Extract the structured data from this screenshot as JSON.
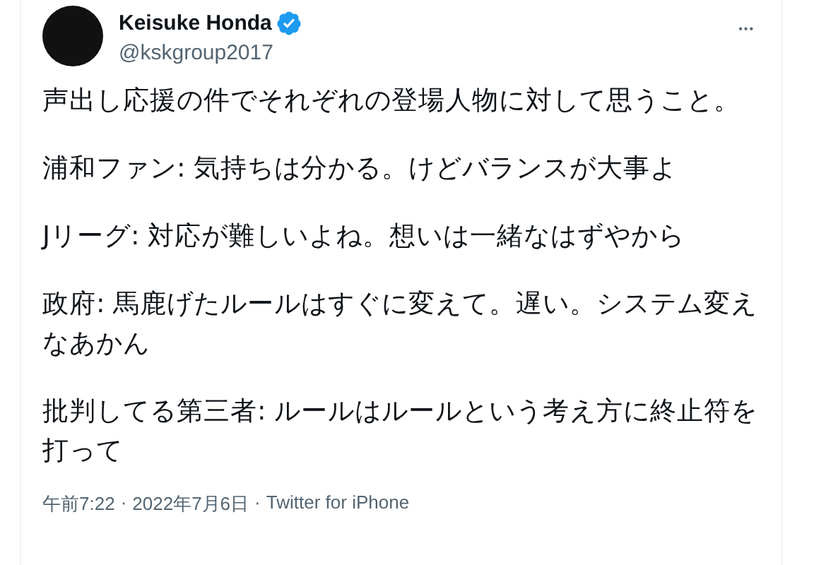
{
  "tweet": {
    "author": {
      "name": "Keisuke Honda",
      "verified": true,
      "handle": "@kskgroup2017"
    },
    "more_menu": "•••",
    "paragraphs": [
      "声出し応援の件でそれぞれの登場人物に対して思うこと。",
      "浦和ファン: 気持ちは分かる。けどバランスが大事よ",
      "Jリーグ: 対応が難しいよね。想いは一緒なはずやから",
      "政府: 馬鹿げたルールはすぐに変えて。遅い。システム変えなあかん",
      "批判してる第三者: ルールはルールという考え方に終止符を打って"
    ],
    "footer": {
      "time": "午前7:22",
      "separator": "·",
      "date": "2022年7月6日",
      "source": "Twitter for iPhone"
    }
  }
}
